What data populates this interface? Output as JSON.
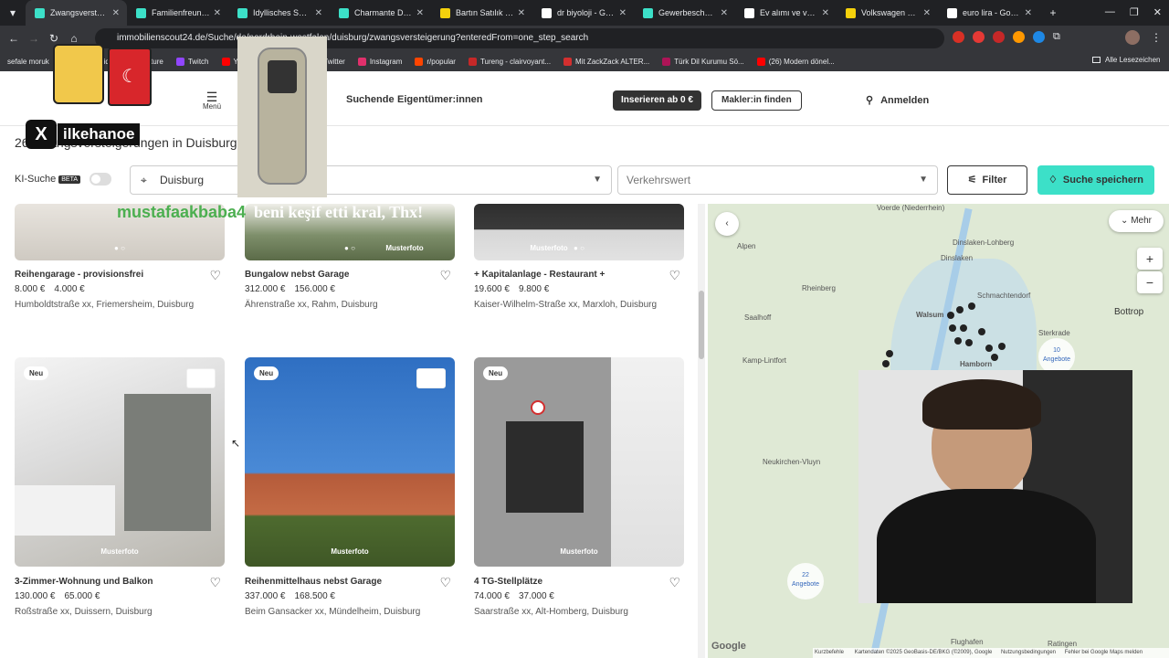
{
  "browser": {
    "tabs": [
      {
        "title": "Zwangsversteigerung",
        "color": "#3ce0c8"
      },
      {
        "title": "Familienfreundliche",
        "color": "#3ce0c8"
      },
      {
        "title": "Idyllisches Sanier",
        "color": "#3ce0c8"
      },
      {
        "title": "Charmante Dopp",
        "color": "#3ce0c8"
      },
      {
        "title": "Bartın Satılık Villa",
        "color": "#f5d10c"
      },
      {
        "title": "dr biyoloji - Goog",
        "color": "#ffffff"
      },
      {
        "title": "Gewerbeschein e",
        "color": "#3ce0c8"
      },
      {
        "title": "Ev alımı ve vergile",
        "color": "#ffffff"
      },
      {
        "title": "Volkswagen Cadd",
        "color": "#f5d10c"
      },
      {
        "title": "euro lira - Google",
        "color": "#ffffff"
      }
    ],
    "new_tab": "+",
    "url": "immobilienscout24.de/Suche/de/nordrhein-westfalen/duisburg/zwangsversteigerung?enteredFrom=one_step_search",
    "bookmarks": [
      "sefale moruk",
      "ki",
      "idee",
      "Future",
      "Twitch",
      "YouTube",
      "Startseite / Twitter",
      "Instagram",
      "r/popular",
      "Tureng - clairvoyant...",
      "Mit ZackZack ALTER...",
      "Türk Dil Kurumu Sö...",
      "(26) Modern dönel..."
    ],
    "all_bookmarks": "Alle Lesezeichen"
  },
  "header": {
    "menu": "Menü",
    "nav": [
      "Suchende",
      "Eigentümer:innen"
    ],
    "insert_btn": "Inserieren ab 0 €",
    "agent_btn": "Makler:in finden",
    "login": "Anmelden"
  },
  "page_title": "26 Zwangsversteigerungen in Duisburg",
  "search": {
    "ki_label": "KI-Suche",
    "beta": "BETA",
    "location": "Duisburg",
    "value_placeholder": "Verkehrswert",
    "filter": "Filter",
    "save": "Suche speichern"
  },
  "listings": [
    {
      "title": "Reihengarage - provisionsfrei",
      "price1": "8.000 €",
      "price2": "4.000 €",
      "addr": "Humboldtstraße xx, Friemersheim, Duisburg",
      "badge": "",
      "musterfoto": ""
    },
    {
      "title": "Bungalow nebst Garage",
      "price1": "312.000 €",
      "price2": "156.000 €",
      "addr": "Ährenstraße xx, Rahm, Duisburg",
      "badge": "",
      "musterfoto": "Musterfoto"
    },
    {
      "title": "+ Kapitalanlage - Restaurant +",
      "price1": "19.600 €",
      "price2": "9.800 €",
      "addr": "Kaiser-Wilhelm-Straße xx, Marxloh, Duisburg",
      "badge": "",
      "musterfoto": "Musterfoto"
    },
    {
      "title": "3-Zimmer-Wohnung und Balkon",
      "price1": "130.000 €",
      "price2": "65.000 €",
      "addr": "Roßstraße xx, Duissern, Duisburg",
      "badge": "Neu",
      "musterfoto": "Musterfoto"
    },
    {
      "title": "Reihenmittelhaus nebst Garage",
      "price1": "337.000 €",
      "price2": "168.500 €",
      "addr": "Beim Gansacker xx, Mündelheim, Duisburg",
      "badge": "Neu",
      "musterfoto": "Musterfoto"
    },
    {
      "title": "4 TG-Stellplätze",
      "price1": "74.000 €",
      "price2": "37.000 €",
      "addr": "Saarstraße xx, Alt-Homberg, Duisburg",
      "badge": "Neu",
      "musterfoto": "Musterfoto"
    }
  ],
  "map": {
    "more": "Mehr",
    "labels": [
      "Voerde (Niederrhein)",
      "Dinslaken-Lohberg",
      "Dinslaken",
      "Alpen",
      "Rheinberg",
      "Schmachtendorf",
      "Saalhoff",
      "Walsum",
      "Bottrop",
      "Sterkrade",
      "Kamp-Lintfort",
      "Hamborn",
      "Neukirchen-Vluyn",
      "Flughafen",
      "Ratingen"
    ],
    "clusters": [
      {
        "count": "10",
        "unit": "Angebote"
      },
      {
        "count": "22",
        "unit": "Angebote"
      }
    ],
    "google": "Google",
    "attribution": [
      "Kurzbefehle",
      "Kartendaten ©2025 GeoBasis-DE/BKG (©2009), Google",
      "Nutzungsbedingungen",
      "Fehler bei Google Maps melden"
    ]
  },
  "overlays": {
    "x_handle": "ilkehanoe",
    "text1": "mustafaakbaba4",
    "text2": "beni keşif etti kral, Thx!"
  },
  "colors": {
    "accent": "#3ce0c8",
    "dark": "#333333"
  }
}
